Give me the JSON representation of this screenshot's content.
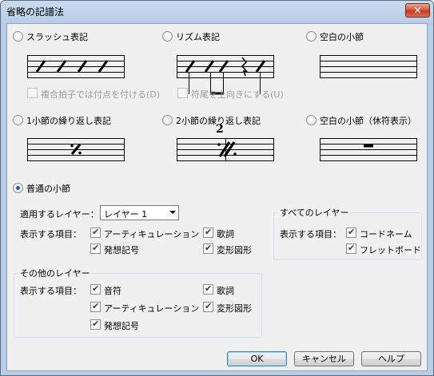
{
  "window": {
    "title": "省略の記譜法",
    "close_glyph": "✕"
  },
  "styles": {
    "slash": {
      "label": "スラッシュ表記",
      "selected": false
    },
    "rhythm": {
      "label": "リズム表記",
      "selected": false
    },
    "blank_measure": {
      "label": "空白の小節",
      "selected": false
    },
    "one_bar_repeat": {
      "label": "1小節の繰り返し表記",
      "selected": false
    },
    "two_bar_repeat": {
      "label": "2小節の繰り返し表記",
      "selected": false,
      "number": "2"
    },
    "blank_measure_rest": {
      "label": "空白の小節（休符表示）",
      "selected": false
    },
    "normal": {
      "label": "普通の小節",
      "selected": true
    }
  },
  "options": {
    "compound_dots": {
      "label": "複合拍子では付点を付ける(D)",
      "checked": false,
      "enabled": false
    },
    "stems_up": {
      "label": "符尾を上向きにする(U)",
      "checked": false,
      "enabled": false
    }
  },
  "apply_layer": {
    "label": "適用するレイヤー：",
    "select_value": "レイヤー 1",
    "show_label": "表示する項目：",
    "items": {
      "articulation": {
        "label": "アーティキュレーション",
        "checked": true
      },
      "lyrics": {
        "label": "歌詞",
        "checked": true
      },
      "expression": {
        "label": "発想記号",
        "checked": true
      },
      "shapes": {
        "label": "変形図形",
        "checked": true
      }
    }
  },
  "all_layers": {
    "title": "すべてのレイヤー",
    "show_label": "表示する項目：",
    "items": {
      "chords": {
        "label": "コードネーム",
        "checked": true
      },
      "fretboards": {
        "label": "フレットボード",
        "checked": true
      }
    }
  },
  "other_layers": {
    "title": "その他のレイヤー",
    "show_label": "表示する項目：",
    "items": {
      "notes": {
        "label": "音符",
        "checked": true
      },
      "lyrics": {
        "label": "歌詞",
        "checked": true
      },
      "articulation": {
        "label": "アーティキュレーション",
        "checked": true
      },
      "shapes": {
        "label": "変形図形",
        "checked": true
      },
      "expression": {
        "label": "発想記号",
        "checked": true
      }
    }
  },
  "buttons": {
    "ok": "OK",
    "cancel": "キャンセル",
    "help": "ヘルプ"
  },
  "colors": {
    "radio_dot": "#1f5fb5",
    "check_mark": "#1c3e85",
    "close_button": "#c23a22",
    "default_button_border": "#3c7fb1"
  }
}
